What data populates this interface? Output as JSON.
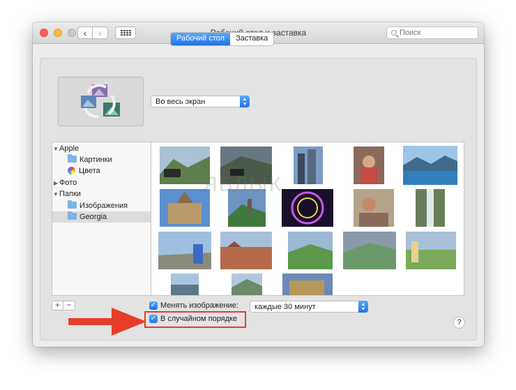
{
  "window": {
    "title": "Рабочий стол и заставка"
  },
  "toolbar": {
    "search_placeholder": "Поиск"
  },
  "tabs": [
    {
      "label": "Рабочий стол",
      "active": true
    },
    {
      "label": "Заставка",
      "active": false
    }
  ],
  "fill_mode": {
    "value": "Во весь экран"
  },
  "sidebar": {
    "items": [
      {
        "label": "Apple",
        "type": "group"
      },
      {
        "label": "Картинки",
        "type": "folder"
      },
      {
        "label": "Цвета",
        "type": "colors"
      },
      {
        "label": "Фото",
        "type": "group"
      },
      {
        "label": "Папки",
        "type": "group"
      },
      {
        "label": "Изображения",
        "type": "folder"
      },
      {
        "label": "Georgia",
        "type": "folder",
        "selected": true
      }
    ]
  },
  "options": {
    "change_picture_label": "Менять изображение:",
    "change_picture_checked": true,
    "interval_value": "каждые 30 минут",
    "random_order_label": "В случайном порядке",
    "random_order_checked": true
  },
  "buttons": {
    "add": "+",
    "remove": "−",
    "help": "?"
  },
  "watermark": "ЯБЛЫК",
  "thumbnails": [
    {
      "scene": "mountain-road-car"
    },
    {
      "scene": "valley-cars-clouds"
    },
    {
      "scene": "city-tall-buildings"
    },
    {
      "scene": "person-indoor"
    },
    {
      "scene": "mountain-lake",
      "selected": true
    },
    {
      "scene": "church-stone"
    },
    {
      "scene": "green-hills-tower"
    },
    {
      "scene": "ferris-wheel-night"
    },
    {
      "scene": "people-at-table"
    },
    {
      "scene": "waterfall"
    },
    {
      "scene": "man-cityscape"
    },
    {
      "scene": "town-rooftops"
    },
    {
      "scene": "green-meadow"
    },
    {
      "scene": "cloudy-hills"
    },
    {
      "scene": "woman-meadow"
    },
    {
      "scene": "person-coast"
    },
    {
      "scene": "mountain-river"
    },
    {
      "scene": "fortress"
    }
  ],
  "colors": {
    "accent": "#2273e6",
    "highlight": "#e73c2a"
  }
}
